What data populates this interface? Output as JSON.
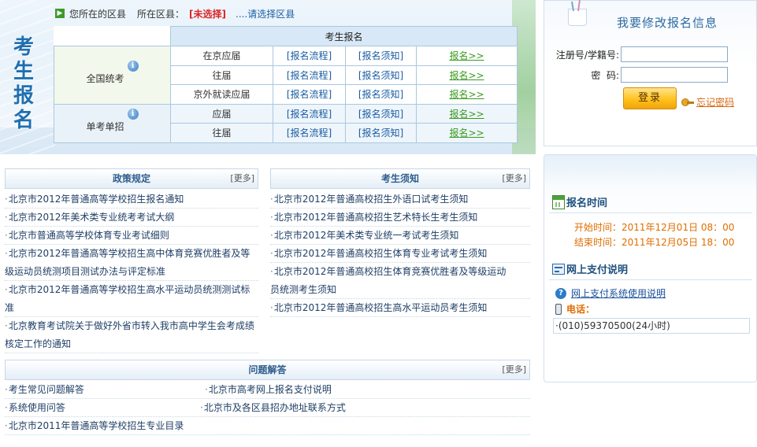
{
  "side_title": [
    "考",
    "生",
    "报",
    "名"
  ],
  "district_bar": {
    "your_district_label": "您所在的区县",
    "district_label": "所在区县：",
    "current_value": "[未选择]",
    "select_link": "....请选择区县"
  },
  "reg_table": {
    "header": "考生报名",
    "groups": [
      {
        "name": "全国统考",
        "rows": [
          {
            "type": "在京应届",
            "flow": "[报名流程]",
            "notice": "[报名须知]",
            "reg": "报名>>"
          },
          {
            "type": "往届",
            "flow": "[报名流程]",
            "notice": "[报名须知]",
            "reg": "报名>>"
          },
          {
            "type": "京外就读应届",
            "flow": "[报名流程]",
            "notice": "[报名须知]",
            "reg": "报名>>"
          }
        ]
      },
      {
        "name": "单考单招",
        "rows": [
          {
            "type": "应届",
            "flow": "[报名流程]",
            "notice": "[报名须知]",
            "reg": "报名>>"
          },
          {
            "type": "往届",
            "flow": "[报名流程]",
            "notice": "[报名须知]",
            "reg": "报名>>"
          }
        ]
      }
    ],
    "info_icon": "i"
  },
  "login": {
    "title": "我要修改报名信息",
    "reg_no_label": "注册号/学籍号:",
    "reg_no_value": "",
    "password_label": "密  码:",
    "password_value": "",
    "login_button": "登录",
    "forgot_link": "忘记密码"
  },
  "info": {
    "reg_time_title": "报名时间",
    "start_time": "开始时间：2011年12月01日 08：00",
    "end_time": "结束时间：2011年12月05日 18：00",
    "pay_title": "网上支付说明",
    "pay_help_link": "网上支付系统使用说明",
    "phone_label": "电话：",
    "phone_number": "·(010)59370500(24小时)",
    "help_icon": "?"
  },
  "policy": {
    "title": "政策规定",
    "more": "[更多]",
    "items": [
      "北京市2012年普通高等学校招生报名通知",
      "北京市2012年美术类专业统考考试大纲",
      "北京市普通高等学校体育专业考试细则",
      "北京市2012年普通高等学校招生高中体育竞赛优胜者及等",
      "级运动员统测项目测试办法与评定标准",
      "北京市2012年普通高等学校招生高水平运动员统测测试标",
      "准",
      "北京教育考试院关于做好外省市转入我市高中学生会考成绩",
      "核定工作的通知"
    ]
  },
  "notice": {
    "title": "考生须知",
    "more": "[更多]",
    "items": [
      "北京市2012年普通高校招生外语口试考生须知",
      "北京市2012年普通高校招生艺术特长生考生须知",
      "北京市2012年美术类专业统一考试考生须知",
      "北京市2012年普通高校招生体育专业考试考生须知",
      "北京市2012年普通高校招生体育竞赛优胜者及等级运动",
      "员统测考生须知",
      "北京市2012年普通高校招生高水平运动员考生须知"
    ]
  },
  "faq": {
    "title": "问题解答",
    "more": "[更多]",
    "left_items": [
      "考生常见问题解答",
      "系统使用问答",
      "北京市2011年普通高等学校招生专业目录"
    ],
    "right_items": [
      "北京市高考网上报名支付说明",
      "北京市及各区县招办地址联系方式"
    ]
  }
}
